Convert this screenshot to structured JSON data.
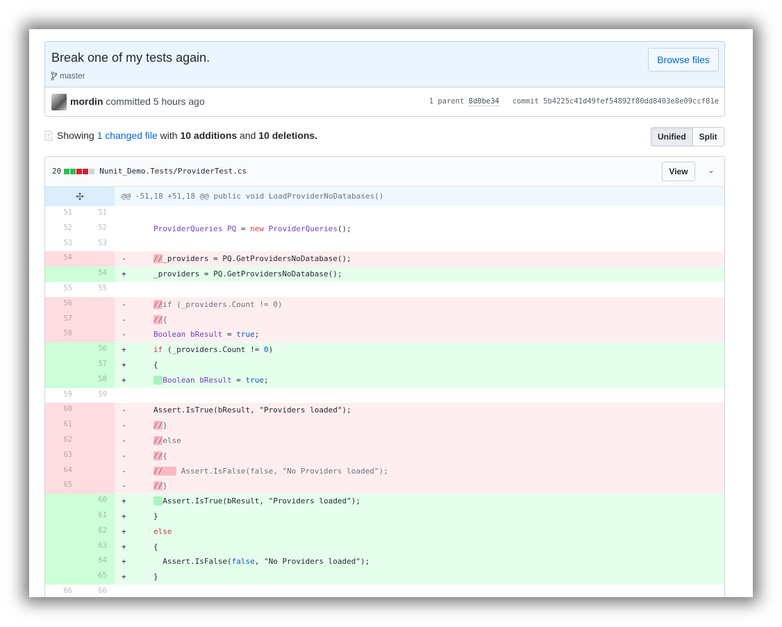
{
  "commit": {
    "title": "Break one of my tests again.",
    "branch": "master",
    "browse_label": "Browse files",
    "author": "mordin",
    "action": "committed 5 hours ago",
    "parent_label": "1 parent",
    "parent_sha": "8d0be34",
    "commit_label": "commit",
    "commit_sha": "5b4225c41d49fef54892f80dd8403e8e09ccf81e"
  },
  "toc": {
    "showing": "Showing",
    "changed_link": "1 changed file",
    "with": "with",
    "additions": "10 additions",
    "and": "and",
    "deletions": "10 deletions",
    "period": "."
  },
  "view_toggle": {
    "unified": "Unified",
    "split": "Split",
    "selected": "Unified"
  },
  "file": {
    "change_count": "20",
    "diffstat": [
      "add",
      "add",
      "del",
      "del",
      "neutral"
    ],
    "diffstat_colors": {
      "add": "#2cbe4e",
      "del": "#cb2431",
      "neutral": "#d1d5da"
    },
    "path": "Nunit_Demo.Tests/ProviderTest.cs",
    "view_label": "View",
    "hunk_header": "@@ -51,18 +51,18 @@ public void LoadProviderNoDatabases()",
    "lines": [
      {
        "type": "ctx",
        "old": "51",
        "new": "51",
        "seg": []
      },
      {
        "type": "ctx",
        "old": "52",
        "new": "52",
        "seg": [
          {
            "t": "ProviderQueries PQ",
            "c": "type"
          },
          {
            "t": " = "
          },
          {
            "t": "new",
            "c": "kw"
          },
          {
            "t": " "
          },
          {
            "t": "ProviderQueries",
            "c": "type"
          },
          {
            "t": "();"
          }
        ]
      },
      {
        "type": "ctx",
        "old": "53",
        "new": "53",
        "seg": []
      },
      {
        "type": "del",
        "old": "54",
        "new": "",
        "seg": [
          {
            "t": "//",
            "c": "hldel"
          },
          {
            "t": "_providers = PQ.GetProvidersNoDatabase();"
          }
        ]
      },
      {
        "type": "add",
        "old": "",
        "new": "54",
        "seg": [
          {
            "t": "_providers = PQ.GetProvidersNoDatabase();"
          }
        ]
      },
      {
        "type": "ctx",
        "old": "55",
        "new": "55",
        "seg": []
      },
      {
        "type": "del",
        "old": "56",
        "new": "",
        "seg": [
          {
            "t": "//",
            "c": "hldel"
          },
          {
            "t": "if (_providers.Count != 0)",
            "c": "cmt"
          }
        ]
      },
      {
        "type": "del",
        "old": "57",
        "new": "",
        "seg": [
          {
            "t": "//",
            "c": "hldel"
          },
          {
            "t": "{",
            "c": "cmt"
          }
        ]
      },
      {
        "type": "del",
        "old": "58",
        "new": "",
        "seg": [
          {
            "t": "Boolean bResult",
            "c": "type"
          },
          {
            "t": " = "
          },
          {
            "t": "true",
            "c": "const"
          },
          {
            "t": ";"
          }
        ]
      },
      {
        "type": "add",
        "old": "",
        "new": "56",
        "seg": [
          {
            "t": "if",
            "c": "kw"
          },
          {
            "t": " (_providers.Count != "
          },
          {
            "t": "0",
            "c": "const"
          },
          {
            "t": ")"
          }
        ]
      },
      {
        "type": "add",
        "old": "",
        "new": "57",
        "seg": [
          {
            "t": "{"
          }
        ]
      },
      {
        "type": "add",
        "old": "",
        "new": "58",
        "seg": [
          {
            "t": "  ",
            "c": "hladd"
          },
          {
            "t": "Boolean bResult",
            "c": "type"
          },
          {
            "t": " = "
          },
          {
            "t": "true",
            "c": "const"
          },
          {
            "t": ";"
          }
        ]
      },
      {
        "type": "ctx",
        "old": "59",
        "new": "59",
        "seg": []
      },
      {
        "type": "del",
        "old": "60",
        "new": "",
        "seg": [
          {
            "t": "Assert.IsTrue(bResult, \"Providers loaded\");"
          }
        ]
      },
      {
        "type": "del",
        "old": "61",
        "new": "",
        "seg": [
          {
            "t": "//",
            "c": "hldel"
          },
          {
            "t": "}",
            "c": "cmt"
          }
        ]
      },
      {
        "type": "del",
        "old": "62",
        "new": "",
        "seg": [
          {
            "t": "//",
            "c": "hldel"
          },
          {
            "t": "else",
            "c": "cmt"
          }
        ]
      },
      {
        "type": "del",
        "old": "63",
        "new": "",
        "seg": [
          {
            "t": "//",
            "c": "hldel"
          },
          {
            "t": "{",
            "c": "cmt"
          }
        ]
      },
      {
        "type": "del",
        "old": "64",
        "new": "",
        "seg": [
          {
            "t": "//   ",
            "c": "hldel"
          },
          {
            "t": " Assert.IsFalse(false, \"No Providers loaded\");",
            "c": "cmt"
          }
        ]
      },
      {
        "type": "del",
        "old": "65",
        "new": "",
        "seg": [
          {
            "t": "//",
            "c": "hldel"
          },
          {
            "t": "}",
            "c": "cmt"
          }
        ]
      },
      {
        "type": "add",
        "old": "",
        "new": "60",
        "seg": [
          {
            "t": "  ",
            "c": "hladd"
          },
          {
            "t": "Assert.IsTrue(bResult, \"Providers loaded\");"
          }
        ]
      },
      {
        "type": "add",
        "old": "",
        "new": "61",
        "seg": [
          {
            "t": "}"
          }
        ]
      },
      {
        "type": "add",
        "old": "",
        "new": "62",
        "seg": [
          {
            "t": "else",
            "c": "kw"
          }
        ]
      },
      {
        "type": "add",
        "old": "",
        "new": "63",
        "seg": [
          {
            "t": "{"
          }
        ]
      },
      {
        "type": "add",
        "old": "",
        "new": "64",
        "seg": [
          {
            "t": "  Assert.IsFalse("
          },
          {
            "t": "false",
            "c": "const"
          },
          {
            "t": ", \"No Providers loaded\");"
          }
        ]
      },
      {
        "type": "add",
        "old": "",
        "new": "65",
        "seg": [
          {
            "t": "}"
          }
        ]
      },
      {
        "type": "ctx",
        "old": "66",
        "new": "66",
        "seg": []
      }
    ]
  }
}
